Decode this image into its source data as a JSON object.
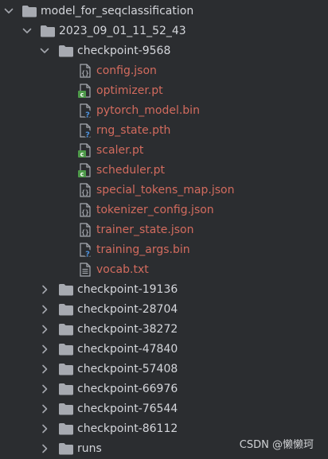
{
  "tree": {
    "root": {
      "label": "model_for_seqclassification",
      "expanded": true
    },
    "run": {
      "label": "2023_09_01_11_52_43",
      "expanded": true
    },
    "checkpoint_open": {
      "label": "checkpoint-9568",
      "expanded": true
    },
    "files": [
      {
        "label": "config.json",
        "icon": "json-file-icon",
        "modified": true
      },
      {
        "label": "optimizer.pt",
        "icon": "pt-file-icon",
        "modified": true
      },
      {
        "label": "pytorch_model.bin",
        "icon": "unknown-file-icon",
        "modified": true
      },
      {
        "label": "rng_state.pth",
        "icon": "unknown-file-icon",
        "modified": true
      },
      {
        "label": "scaler.pt",
        "icon": "pt-file-icon",
        "modified": true
      },
      {
        "label": "scheduler.pt",
        "icon": "pt-file-icon",
        "modified": true
      },
      {
        "label": "special_tokens_map.json",
        "icon": "json-file-icon",
        "modified": true
      },
      {
        "label": "tokenizer_config.json",
        "icon": "json-file-icon",
        "modified": true
      },
      {
        "label": "trainer_state.json",
        "icon": "json-file-icon",
        "modified": true
      },
      {
        "label": "training_args.bin",
        "icon": "unknown-file-icon",
        "modified": true
      },
      {
        "label": "vocab.txt",
        "icon": "text-file-icon",
        "modified": true
      }
    ],
    "collapsed_folders": [
      {
        "label": "checkpoint-19136"
      },
      {
        "label": "checkpoint-28704"
      },
      {
        "label": "checkpoint-38272"
      },
      {
        "label": "checkpoint-47840"
      },
      {
        "label": "checkpoint-57408"
      },
      {
        "label": "checkpoint-66976"
      },
      {
        "label": "checkpoint-76544"
      },
      {
        "label": "checkpoint-86112"
      },
      {
        "label": "runs"
      }
    ]
  },
  "watermark": "CSDN @懒懒珂",
  "colors": {
    "background": "#2b2d30",
    "folder_text": "#d4d6db",
    "modified_file_text": "#d26b5e",
    "folder_icon": "#a7aab1",
    "chevron": "#a3a6ad",
    "pt_badge": "#4e9a4a",
    "unknown_badge": "#4d8fd8"
  }
}
